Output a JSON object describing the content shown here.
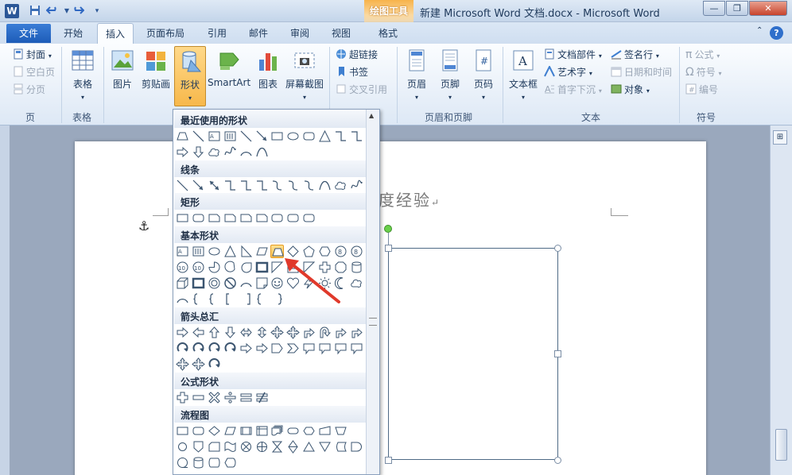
{
  "window": {
    "app_letter": "W",
    "title": "新建 Microsoft Word 文档.docx - Microsoft Word",
    "context_tab_group": "绘图工具",
    "minimize_symbol": "—",
    "maximize_symbol": "❐",
    "close_symbol": "✕"
  },
  "qat": {
    "save_icon": "save-icon",
    "undo_icon": "undo-icon",
    "redo_icon": "redo-icon",
    "customize_icon": "customize-qat-icon"
  },
  "tabs": [
    {
      "label": "文件"
    },
    {
      "label": "开始"
    },
    {
      "label": "插入"
    },
    {
      "label": "页面布局"
    },
    {
      "label": "引用"
    },
    {
      "label": "邮件"
    },
    {
      "label": "审阅"
    },
    {
      "label": "视图"
    },
    {
      "label": "格式"
    }
  ],
  "ribbon": {
    "pages": {
      "cover": "封面",
      "blank_page": "空白页",
      "page_break": "分页",
      "group": "页"
    },
    "tables": {
      "table": "表格",
      "group": "表格"
    },
    "illustrations": {
      "picture": "图片",
      "clip_art": "剪贴画",
      "shapes": "形状",
      "smartart": "SmartArt",
      "chart": "图表",
      "screenshot": "屏幕截图"
    },
    "links": {
      "hyperlink": "超链接",
      "bookmark": "书签",
      "cross_ref": "交叉引用"
    },
    "header_footer": {
      "header": "页眉",
      "footer": "页脚",
      "page_number": "页码",
      "group": "页眉和页脚"
    },
    "text": {
      "text_box": "文本框",
      "quick_parts": "文档部件",
      "wordart": "艺术字",
      "drop_cap": "首字下沉",
      "signature": "签名行",
      "date_time": "日期和时间",
      "object": "对象",
      "group": "文本"
    },
    "symbols": {
      "equation": "公式",
      "symbol": "符号",
      "numbering": "编号",
      "group": "符号"
    }
  },
  "gallery": {
    "sections": {
      "recent": "最近使用的形状",
      "lines": "线条",
      "rectangles": "矩形",
      "basic": "基本形状",
      "block_arrows": "箭头总汇",
      "equation": "公式形状",
      "flowchart": "流程图"
    },
    "highlighted_shape": "trapezoid-shape"
  },
  "document": {
    "title_fragment": "度经验",
    "paragraph_mark": "↵"
  },
  "colors": {
    "accent_orange": "#f7b84b",
    "file_tab_blue": "#1d5cb8",
    "annotation_red": "#e0392b",
    "rotation_handle_green": "#6ad04b"
  }
}
